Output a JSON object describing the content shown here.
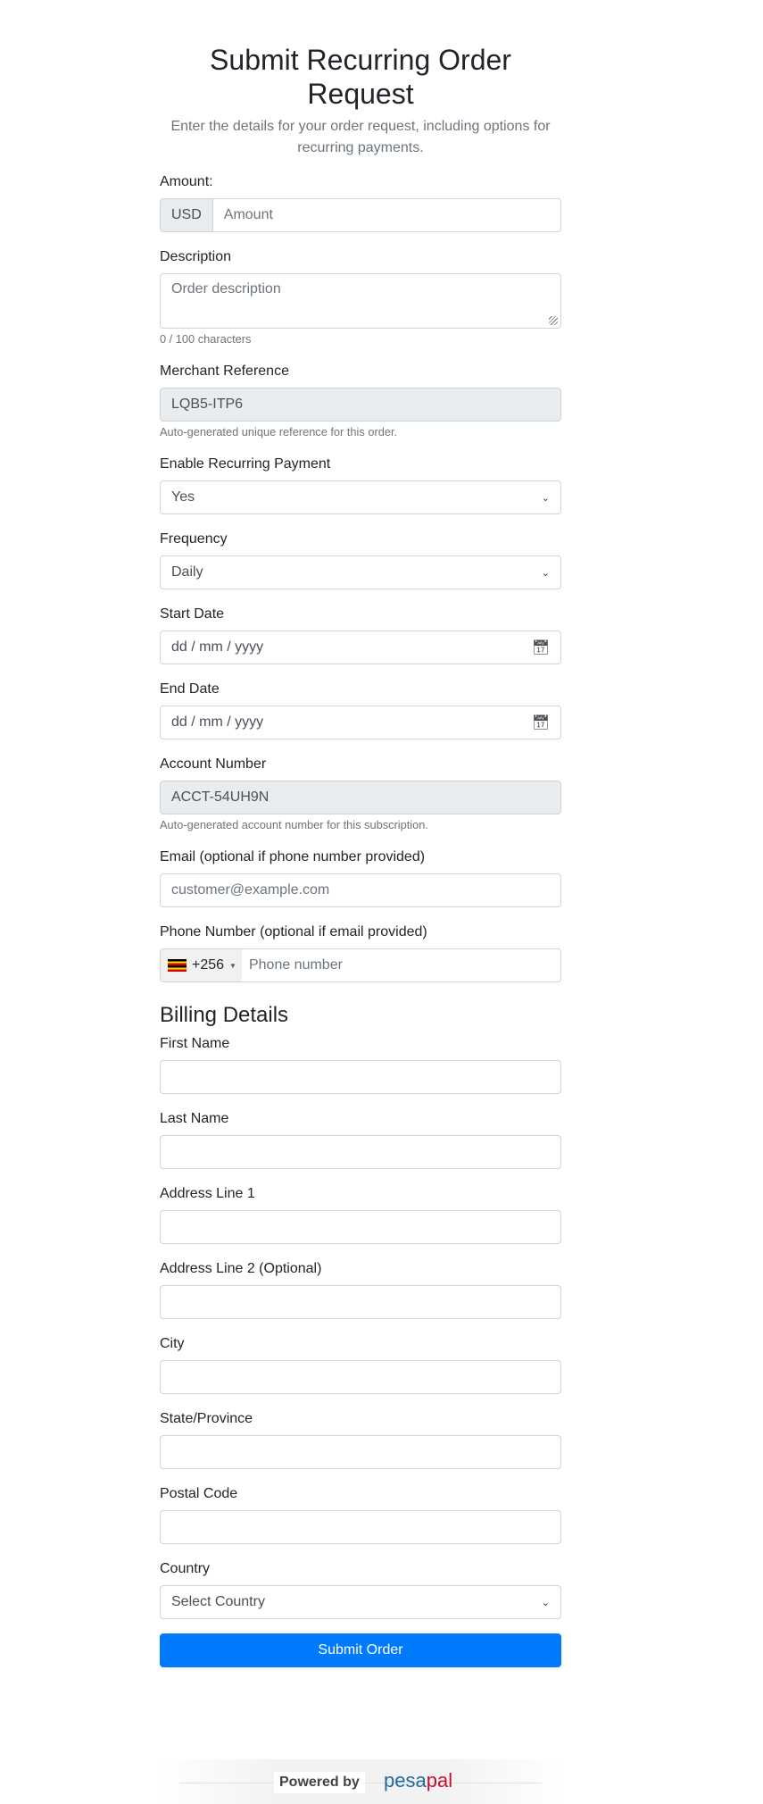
{
  "header": {
    "title": "Submit Recurring Order Request",
    "subtitle": "Enter the details for your order request, including options for recurring payments."
  },
  "amount": {
    "label": "Amount:",
    "currency": "USD",
    "placeholder": "Amount"
  },
  "description": {
    "label": "Description",
    "placeholder": "Order description",
    "counter": "0 / 100 characters"
  },
  "merchant_reference": {
    "label": "Merchant Reference",
    "value": "LQB5-ITP6",
    "help": "Auto-generated unique reference for this order."
  },
  "recurring": {
    "label": "Enable Recurring Payment",
    "value": "Yes"
  },
  "frequency": {
    "label": "Frequency",
    "value": "Daily"
  },
  "start_date": {
    "label": "Start Date",
    "placeholder": "dd / mm / yyyy"
  },
  "end_date": {
    "label": "End Date",
    "placeholder": "dd / mm / yyyy"
  },
  "account_number": {
    "label": "Account Number",
    "value": "ACCT-54UH9N",
    "help": "Auto-generated account number for this subscription."
  },
  "email": {
    "label": "Email (optional if phone number provided)",
    "placeholder": "customer@example.com"
  },
  "phone": {
    "label": "Phone Number (optional if email provided)",
    "dial_code": "+256",
    "placeholder": "Phone number"
  },
  "billing": {
    "title": "Billing Details",
    "first_name": "First Name",
    "last_name": "Last Name",
    "address1": "Address Line 1",
    "address2": "Address Line 2 (Optional)",
    "city": "City",
    "state": "State/Province",
    "postal": "Postal Code",
    "country_label": "Country",
    "country_value": "Select Country"
  },
  "submit_label": "Submit Order",
  "footer": {
    "powered_by": "Powered by",
    "logo_a": "pesa",
    "logo_b": "pal"
  },
  "colors": {
    "primary": "#007bff"
  }
}
